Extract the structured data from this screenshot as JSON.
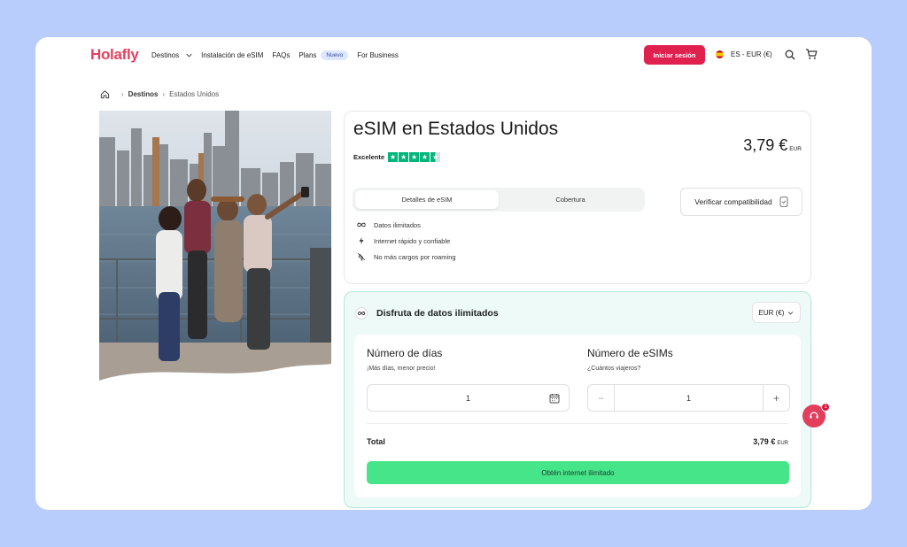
{
  "header": {
    "logo": "Holafly",
    "nav": [
      {
        "label": "Destinos"
      },
      {
        "label": "Instalación de eSIM"
      },
      {
        "label": "FAQs"
      },
      {
        "label": "Plans",
        "badge": "Nuevo"
      },
      {
        "label": "For Business"
      }
    ],
    "login_label": "Iniciar sesión",
    "language": "ES - EUR (€)"
  },
  "breadcrumb": [
    "Destinos",
    "Estados Unidos"
  ],
  "product": {
    "title": "eSIM en Estados Unidos",
    "price": "3,79 €",
    "price_currency": "EUR",
    "rating_label": "Excelente",
    "rating_stars": 4.5,
    "tabs": [
      "Detalles de eSIM",
      "Cobertura"
    ],
    "active_tab": 0,
    "verify_label": "Verificar compatibilidad",
    "features": [
      "Datos ilimitados",
      "Internet rápido y confiable",
      "No más cargos por roaming"
    ]
  },
  "purchase": {
    "unlimited_label": "Disfruta de datos ilimitados",
    "currency_select": "EUR (€)",
    "days": {
      "title": "Número de días",
      "subtitle": "¡Más días, menor precio!",
      "value": "1"
    },
    "esims": {
      "title": "Número de eSIMs",
      "subtitle": "¿Cuántos viajeros?",
      "value": "1",
      "minus": "−",
      "plus": "+"
    },
    "total_label": "Total",
    "total_value": "3,79 €",
    "total_currency": "EUR",
    "cta_label": "Obtén internet ilimitado"
  },
  "chat": {
    "badge": "1"
  },
  "colors": {
    "brand": "#e6405f",
    "login": "#e0204e",
    "cta": "#47e589",
    "rating": "#00b67a",
    "purchase_bg": "#edfaf8"
  }
}
